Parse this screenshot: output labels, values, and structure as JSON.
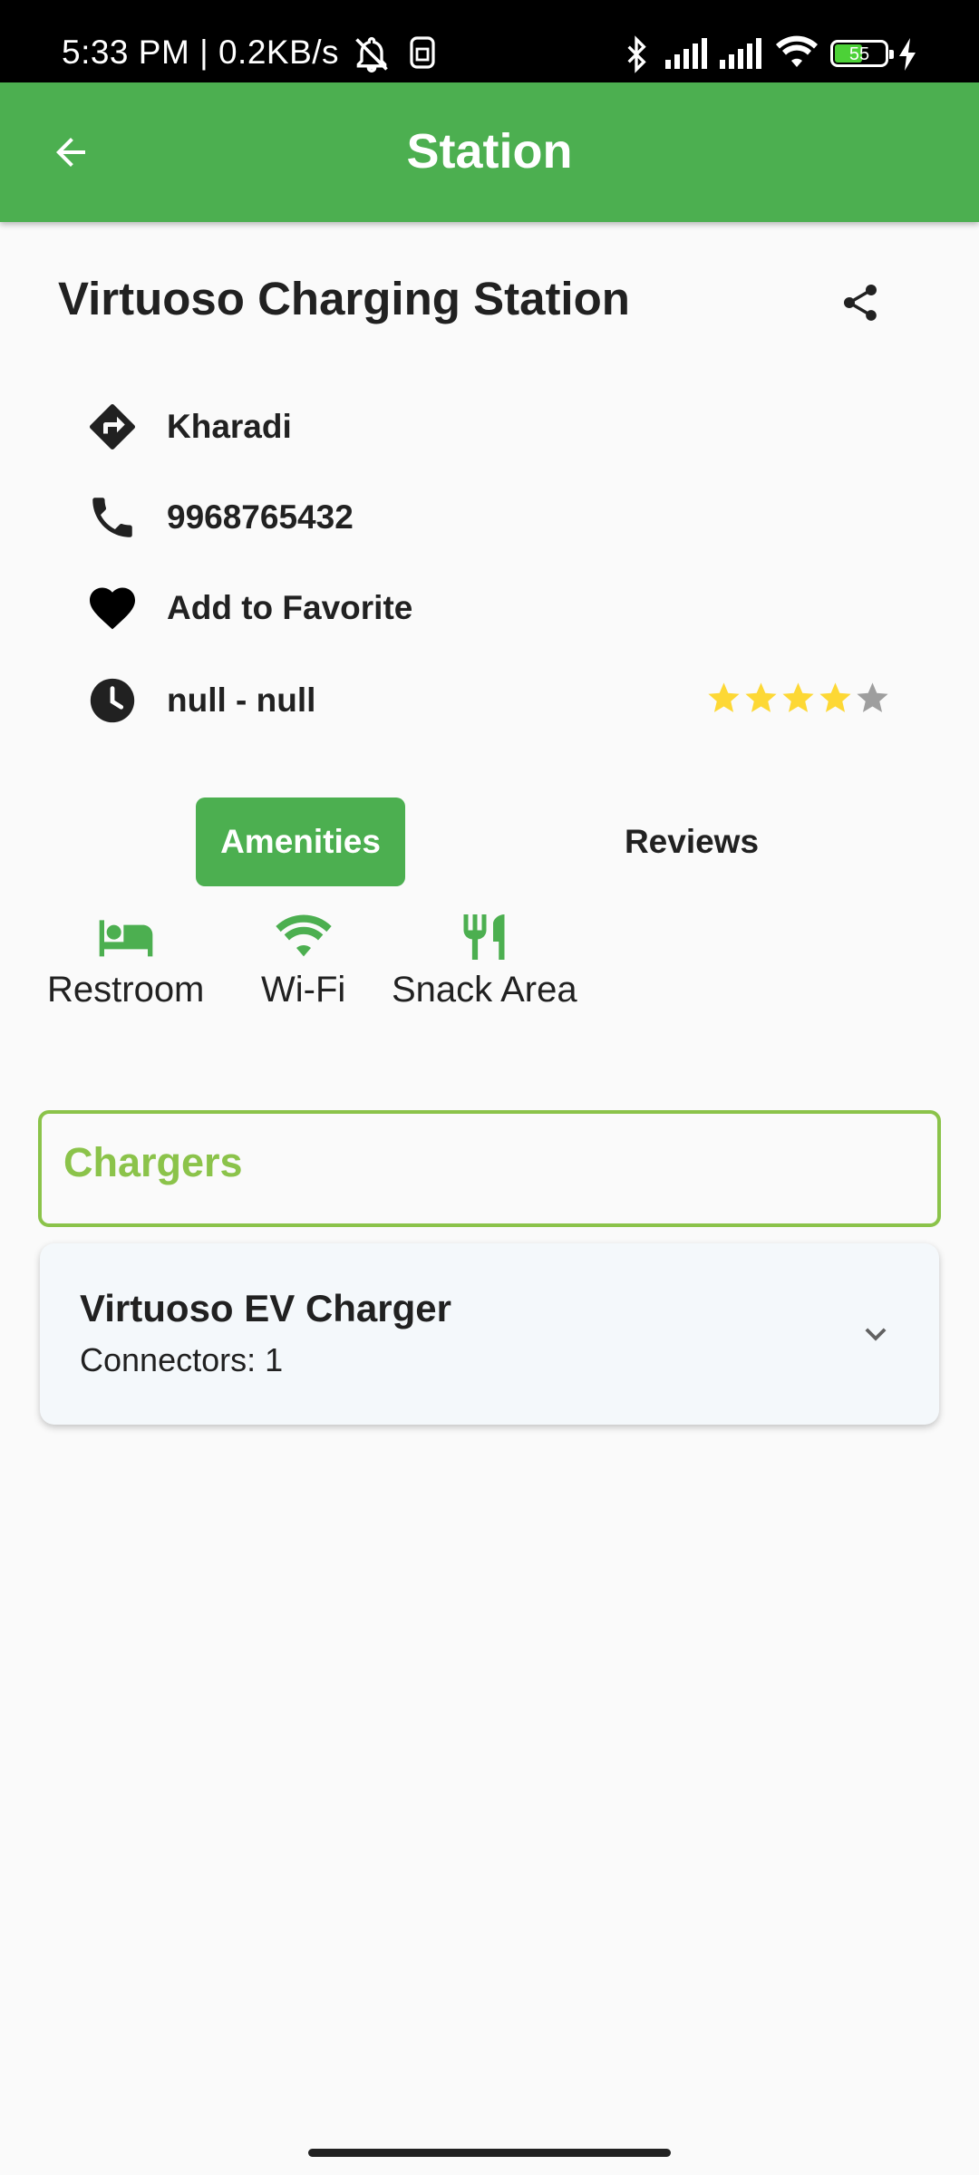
{
  "status_bar": {
    "time_text": "5:33 PM | 0.2KB/s",
    "battery_percent": "55",
    "battery_level": 0.55,
    "icons": [
      "mute-bell-icon",
      "sim-icon",
      "bluetooth-icon",
      "signal-icon",
      "signal-icon",
      "wifi-icon",
      "battery-icon",
      "charging-icon"
    ]
  },
  "app_bar": {
    "title": "Station",
    "back_icon": "arrow-back-icon"
  },
  "station": {
    "name": "Virtuoso Charging Station",
    "share_icon": "share-icon",
    "location": "Kharadi",
    "phone": "9968765432",
    "favorite_label": "Add to Favorite",
    "hours": "null - null",
    "rating": 4,
    "rating_max": 5
  },
  "tabs": {
    "amenities_label": "Amenities",
    "reviews_label": "Reviews",
    "active": "Amenities"
  },
  "amenities": [
    {
      "label": "Restroom",
      "icon": "bed-icon"
    },
    {
      "label": "Wi-Fi",
      "icon": "wifi-icon"
    },
    {
      "label": "Snack Area",
      "icon": "restaurant-icon"
    }
  ],
  "chargers": {
    "section_label": "Chargers",
    "items": [
      {
        "name": "Virtuoso EV Charger",
        "connectors_text": "Connectors: 1"
      }
    ]
  },
  "colors": {
    "primary": "#4caf50",
    "accent_light": "#8bc34a",
    "star_filled": "#fdd835",
    "star_empty": "#9e9e9e"
  }
}
